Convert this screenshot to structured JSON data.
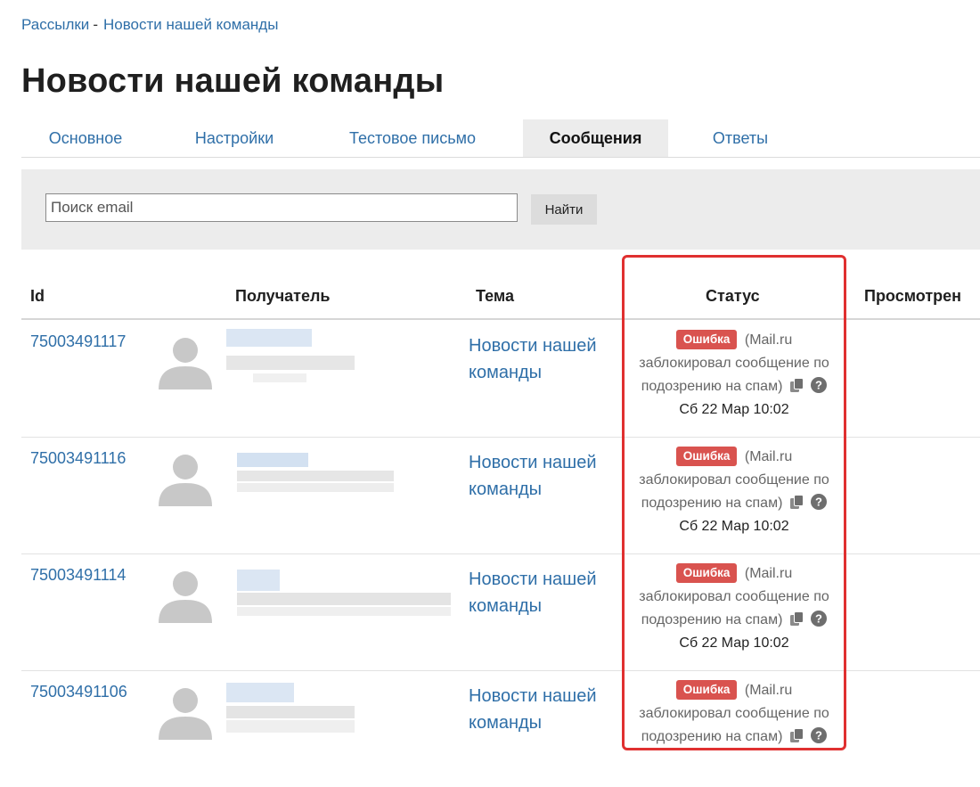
{
  "breadcrumb": {
    "parent": "Рассылки",
    "separator": "-",
    "current": "Новости нашей команды"
  },
  "page_title": "Новости нашей команды",
  "tabs": [
    {
      "label": "Основное",
      "active": false
    },
    {
      "label": "Настройки",
      "active": false
    },
    {
      "label": "Тестовое письмо",
      "active": false
    },
    {
      "label": "Сообщения",
      "active": true
    },
    {
      "label": "Ответы",
      "active": false
    }
  ],
  "search": {
    "placeholder": "Поиск email",
    "value": "",
    "button_label": "Найти"
  },
  "table": {
    "headers": {
      "id": "Id",
      "recipient": "Получатель",
      "subject": "Тема",
      "status": "Статус",
      "viewed": "Просмотрен"
    },
    "rows": [
      {
        "id": "75003491117",
        "subject": "Новости нашей команды",
        "badge": "Ошибка",
        "status_text": "(Mail.ru заблокировал сообщение по подозрению на спам)",
        "date": "Сб 22 Мар 10:02"
      },
      {
        "id": "75003491116",
        "subject": "Новости нашей команды",
        "badge": "Ошибка",
        "status_text": "(Mail.ru заблокировал сообщение по подозрению на спам)",
        "date": "Сб 22 Мар 10:02"
      },
      {
        "id": "75003491114",
        "subject": "Новости нашей команды",
        "badge": "Ошибка",
        "status_text": "(Mail.ru заблокировал сообщение по подозрению на спам)",
        "date": "Сб 22 Мар 10:02"
      },
      {
        "id": "75003491106",
        "subject": "Новости нашей команды",
        "badge": "Ошибка",
        "status_text": "(Mail.ru заблокировал сообщение по подозрению на спам)",
        "date": ""
      }
    ]
  },
  "colors": {
    "link": "#2f6fa8",
    "error_badge": "#d9534f",
    "highlight": "#e03030",
    "panel": "#ececec"
  },
  "icons": {
    "avatar": "user-silhouette-icon",
    "copy": "copy-icon",
    "help": "question-circle-icon"
  }
}
